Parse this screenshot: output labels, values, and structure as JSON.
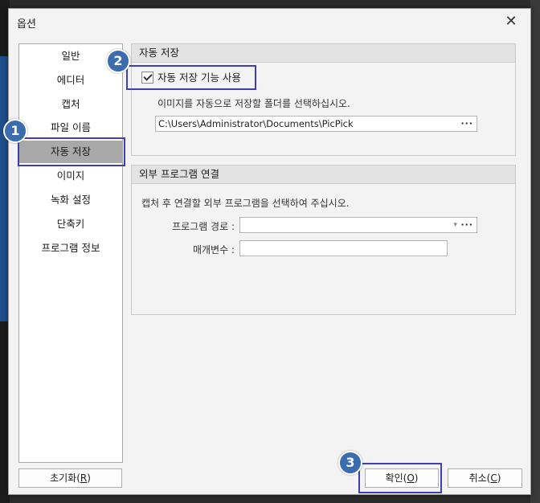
{
  "dialog": {
    "title": "옵션",
    "close_glyph": "✕"
  },
  "nav": {
    "items": [
      "일반",
      "에디터",
      "캡처",
      "파일 이름",
      "자동 저장",
      "이미지",
      "녹화 설정",
      "단축키",
      "프로그램 정보"
    ],
    "selected": "자동 저장",
    "reset_button": {
      "label_prefix": "초기화(",
      "mnemonic": "R",
      "label_suffix": ")"
    }
  },
  "autosave": {
    "header": "자동 저장",
    "checkbox_label": "자동 저장 기능 사용",
    "checked": true,
    "hint": "이미지를 자동으로 저장할 폴더를 선택하십시오.",
    "folder_path": "C:\\Users\\Administrator\\Documents\\PicPick",
    "browse_glyph": "···"
  },
  "external": {
    "header": "외부 프로그램 연결",
    "hint": "캡처 후 연결할 외부 프로그램을 선택하여 주십시오.",
    "program_path_label": "프로그램 경로 :",
    "program_path_value": "",
    "params_label": "매개변수 :",
    "params_value": "",
    "browse_glyph": "···",
    "dropdown_glyph": "▾"
  },
  "buttons": {
    "ok": {
      "label_prefix": "확인(",
      "mnemonic": "O",
      "label_suffix": ")"
    },
    "cancel": {
      "label_prefix": "취소(",
      "mnemonic": "C",
      "label_suffix": ")"
    }
  },
  "annotations": {
    "badge1": "1",
    "badge2": "2",
    "badge3": "3",
    "color": "#3b6cae",
    "box_color": "#3f3fb0"
  }
}
